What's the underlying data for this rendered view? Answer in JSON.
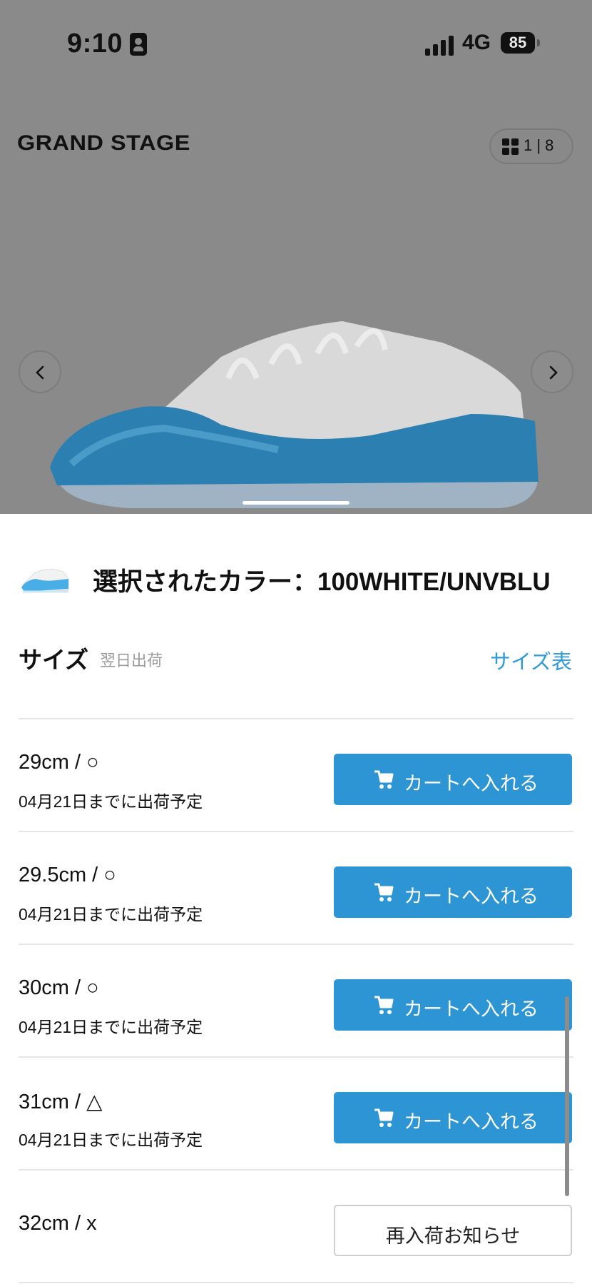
{
  "status_bar": {
    "time": "9:10",
    "network": "4G",
    "battery": "85"
  },
  "header": {
    "brand": "GRAND STAGE",
    "gallery_counter": "1 | 8"
  },
  "selected_color": {
    "label": "選択されたカラー：100WHITE/UNVBLU"
  },
  "size_section": {
    "title": "サイズ",
    "note": "翌日出荷",
    "size_chart_link": "サイズ表"
  },
  "sizes": [
    {
      "size": "29cm / ○",
      "ship": "04月21日までに出荷予定",
      "button": "カートへ入れる"
    },
    {
      "size": "29.5cm / ○",
      "ship": "04月21日までに出荷予定",
      "button": "カートへ入れる"
    },
    {
      "size": "30cm / ○",
      "ship": "04月21日までに出荷予定",
      "button": "カートへ入れる"
    },
    {
      "size": "31cm / △",
      "ship": "04月21日までに出荷予定",
      "button": "カートへ入れる"
    },
    {
      "size": "32cm / x",
      "ship": "",
      "button": "再入荷お知らせ"
    }
  ],
  "colors": {
    "accent": "#2d95d3",
    "overlay": "#8a8a8a",
    "link": "#2f9bd6"
  }
}
